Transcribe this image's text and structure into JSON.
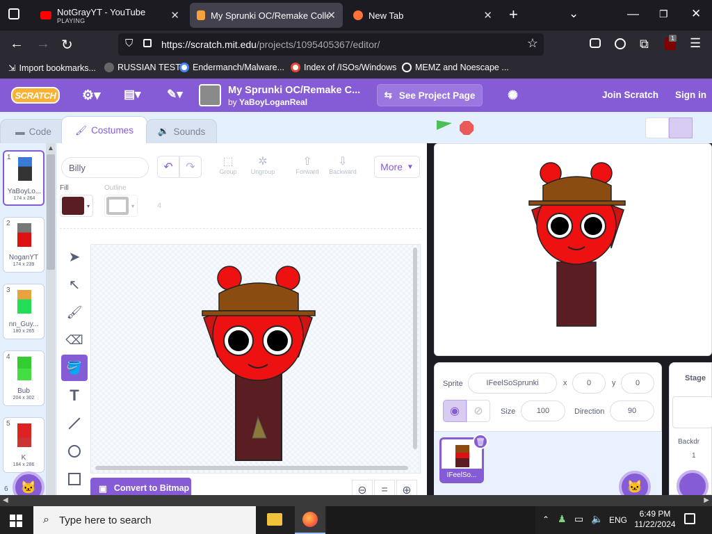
{
  "browser": {
    "tabs": [
      {
        "title": "NotGrayYT - YouTube",
        "subtitle": "PLAYING"
      },
      {
        "title": "My Sprunki OC/Remake Collect"
      },
      {
        "title": "New Tab"
      }
    ],
    "url_host": "https://scratch.mit.edu",
    "url_path": "/projects/1095405367/editor/",
    "extension_badge": "1",
    "bookmarks": [
      "Import bookmarks...",
      "RUSSIAN TEST",
      "Endermanch/Malware...",
      "Index of /ISOs/Windows",
      "MEMZ and Noescape ..."
    ]
  },
  "scratch": {
    "logo": "SCRATCH",
    "project_title": "My Sprunki OC/Remake C...",
    "project_by_prefix": "by",
    "project_author": "YaBoyLoganReal",
    "see_project_page": "See Project Page",
    "join": "Join Scratch",
    "signin": "Sign in",
    "tabs": {
      "code": "Code",
      "costumes": "Costumes",
      "sounds": "Sounds"
    },
    "costumes": [
      {
        "num": "1",
        "name": "YaBoyLo...",
        "size": "174 x 264"
      },
      {
        "num": "2",
        "name": "NoganYT",
        "size": "174 x 239"
      },
      {
        "num": "3",
        "name": "nn_Guy...",
        "size": "180 x 265"
      },
      {
        "num": "4",
        "name": "Bub",
        "size": "204 x 302"
      },
      {
        "num": "5",
        "name": "K",
        "size": "184 x 286"
      },
      {
        "num": "6",
        "name": "",
        "size": ""
      }
    ],
    "costume_name": "Billy",
    "labels": {
      "fill": "Fill",
      "outline": "Outline",
      "outline_width": "4",
      "group": "Group",
      "ungroup": "Ungroup",
      "forward": "Forward",
      "backward": "Backward",
      "more": "More",
      "convert": "Convert to Bitmap",
      "zoom_reset": "="
    },
    "fill_color": "#5a1e22",
    "sprite": {
      "label": "Sprite",
      "name": "IFeelSoSprunki",
      "x_label": "x",
      "x": "0",
      "y_label": "y",
      "y": "0",
      "size_label": "Size",
      "size": "100",
      "direction_label": "Direction",
      "direction": "90",
      "thumb_name": "IFeelSo..."
    },
    "stage_label": "Stage",
    "backdrops_label": "Backdr",
    "backdrops_count": "1"
  },
  "taskbar": {
    "search": "Type here to search",
    "lang": "ENG",
    "time": "6:49 PM",
    "date": "11/22/2024"
  }
}
